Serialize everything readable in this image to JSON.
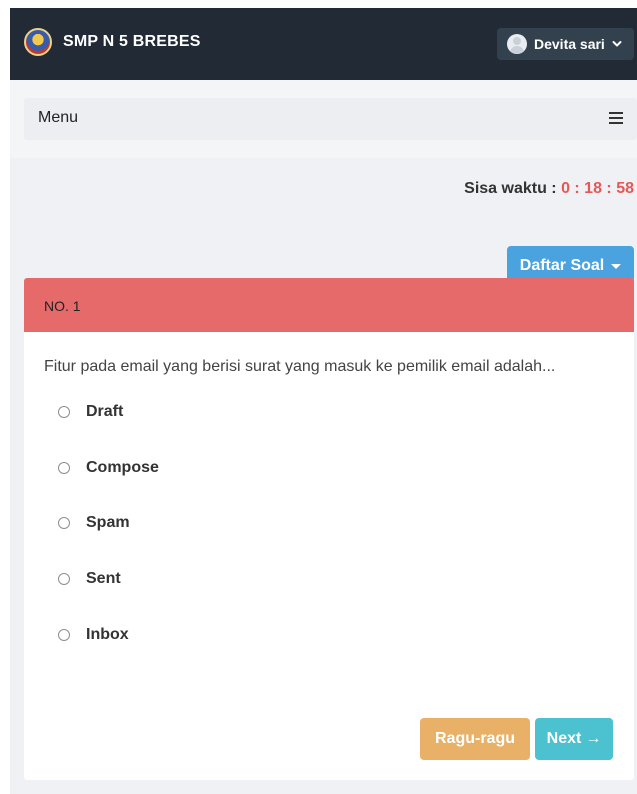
{
  "navbar": {
    "brand_name": "SMP N 5 BREBES",
    "user_name": "Devita sari"
  },
  "menubar": {
    "label": "Menu"
  },
  "timer": {
    "label": "Sisa waktu : ",
    "value": "0 : 18 : 58"
  },
  "daftar_button": {
    "label": "Daftar Soal"
  },
  "question": {
    "number_label": "NO. 1",
    "text": "Fitur pada email yang berisi surat yang masuk ke pemilik email adalah...",
    "options": [
      "Draft",
      "Compose",
      "Spam",
      "Sent",
      "Inbox"
    ]
  },
  "actions": {
    "ragu_label": "Ragu-ragu",
    "next_label": "Next",
    "next_arrow": "→"
  },
  "colors": {
    "navbar": "#222a35",
    "question_header": "#e76a6a",
    "timer_value": "#e45858",
    "daftar_button": "#4aa3df",
    "ragu_button": "#e8b167",
    "next_button": "#4cc1cf"
  },
  "icons": {
    "brand": "school-logo-icon",
    "user": "avatar-icon",
    "user_menu": "chevron-down-icon",
    "menu": "hamburger-menu-icon",
    "daftar": "caret-down-icon",
    "next": "arrow-right-icon",
    "option": "radio-icon"
  }
}
